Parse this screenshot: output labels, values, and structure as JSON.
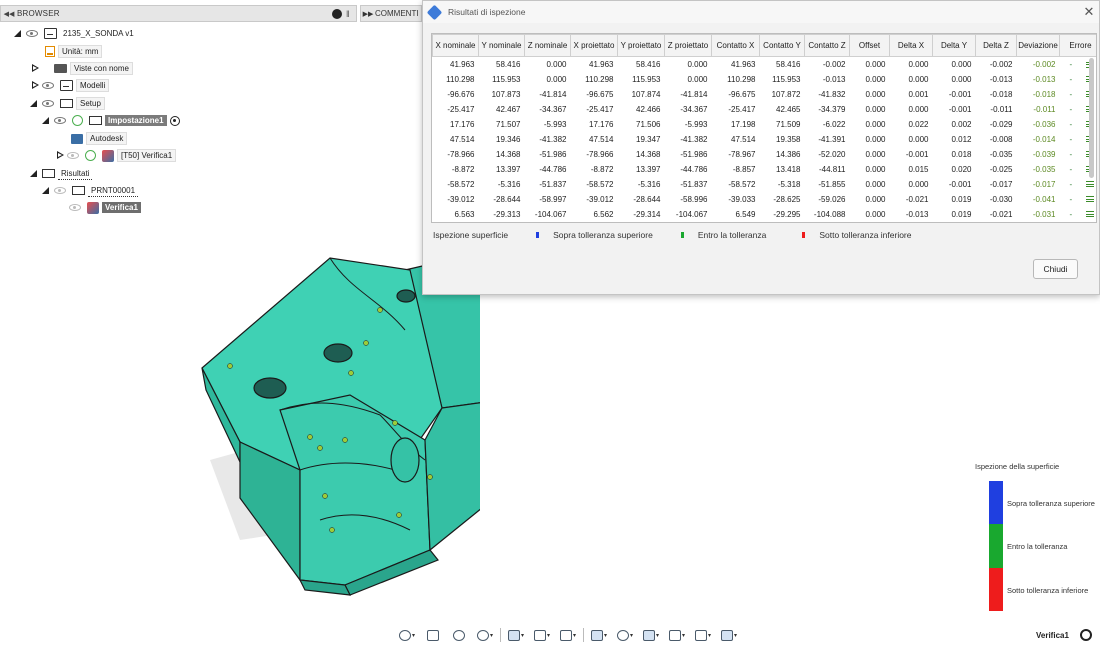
{
  "panels": {
    "browser": {
      "title": "BROWSER",
      "collapse_icon": "double-chevron-left-icon"
    },
    "comments": {
      "title": "COMMENTI"
    }
  },
  "tree": {
    "document": "2135_X_SONDA v1",
    "units": "Unità: mm",
    "named_views": "Viste con nome",
    "models": "Modelli",
    "setup": "Setup",
    "setup1": "Impostazione1",
    "autodesk": "Autodesk",
    "op": "[T50] Verifica1",
    "results": "Risultati",
    "prnt": "PRNT00001",
    "inspection": "Verifica1"
  },
  "dialog": {
    "title": "Risultati di ispezione",
    "close_label": "Chiudi",
    "columns": [
      "X nominale",
      "Y nominale",
      "Z nominale",
      "X proiettato",
      "Y proiettato",
      "Z proiettato",
      "Contatto X",
      "Contatto Y",
      "Contatto Z",
      "Offset",
      "Delta X",
      "Delta Y",
      "Delta Z",
      "Deviazione",
      "Errore"
    ],
    "rows": [
      [
        "41.963",
        "58.416",
        "0.000",
        "41.963",
        "58.416",
        "0.000",
        "41.963",
        "58.416",
        "-0.002",
        "0.000",
        "0.000",
        "0.000",
        "-0.002",
        "-0.002",
        "-"
      ],
      [
        "110.298",
        "115.953",
        "0.000",
        "110.298",
        "115.953",
        "0.000",
        "110.298",
        "115.953",
        "-0.013",
        "0.000",
        "0.000",
        "0.000",
        "-0.013",
        "-0.013",
        "-"
      ],
      [
        "-96.676",
        "107.873",
        "-41.814",
        "-96.675",
        "107.874",
        "-41.814",
        "-96.675",
        "107.872",
        "-41.832",
        "0.000",
        "0.001",
        "-0.001",
        "-0.018",
        "-0.018",
        "-"
      ],
      [
        "-25.417",
        "42.467",
        "-34.367",
        "-25.417",
        "42.466",
        "-34.367",
        "-25.417",
        "42.465",
        "-34.379",
        "0.000",
        "0.000",
        "-0.001",
        "-0.011",
        "-0.011",
        "-"
      ],
      [
        "17.176",
        "71.507",
        "-5.993",
        "17.176",
        "71.506",
        "-5.993",
        "17.198",
        "71.509",
        "-6.022",
        "0.000",
        "0.022",
        "0.002",
        "-0.029",
        "-0.036",
        "-"
      ],
      [
        "47.514",
        "19.346",
        "-41.382",
        "47.514",
        "19.347",
        "-41.382",
        "47.514",
        "19.358",
        "-41.391",
        "0.000",
        "0.000",
        "0.012",
        "-0.008",
        "-0.014",
        "-"
      ],
      [
        "-78.966",
        "14.368",
        "-51.986",
        "-78.966",
        "14.368",
        "-51.986",
        "-78.967",
        "14.386",
        "-52.020",
        "0.000",
        "-0.001",
        "0.018",
        "-0.035",
        "-0.039",
        "-"
      ],
      [
        "-8.872",
        "13.397",
        "-44.786",
        "-8.872",
        "13.397",
        "-44.786",
        "-8.857",
        "13.418",
        "-44.811",
        "0.000",
        "0.015",
        "0.020",
        "-0.025",
        "-0.035",
        "-"
      ],
      [
        "-58.572",
        "-5.316",
        "-51.837",
        "-58.572",
        "-5.316",
        "-51.837",
        "-58.572",
        "-5.318",
        "-51.855",
        "0.000",
        "0.000",
        "-0.001",
        "-0.017",
        "-0.017",
        "-"
      ],
      [
        "-39.012",
        "-28.644",
        "-58.997",
        "-39.012",
        "-28.644",
        "-58.996",
        "-39.033",
        "-28.625",
        "-59.026",
        "0.000",
        "-0.021",
        "0.019",
        "-0.030",
        "-0.041",
        "-"
      ],
      [
        "6.563",
        "-29.313",
        "-104.067",
        "6.562",
        "-29.314",
        "-104.067",
        "6.549",
        "-29.295",
        "-104.088",
        "0.000",
        "-0.013",
        "0.019",
        "-0.021",
        "-0.031",
        "-"
      ]
    ],
    "legend": {
      "surface": "Ispezione superficie",
      "above": "Sopra tolleranza superiore",
      "within": "Entro la tolleranza",
      "below": "Sotto tolleranza inferiore"
    }
  },
  "viewport_legend": {
    "title": "Ispezione della superficie",
    "above": "Sopra tolleranza superiore",
    "within": "Entro la tolleranza",
    "below": "Sotto tolleranza inferiore"
  },
  "colors": {
    "above": "#1f3fe0",
    "within": "#19a82f",
    "below": "#ee1c1c",
    "model": "#3fd1b4"
  },
  "status": {
    "name": "Verifica1"
  }
}
